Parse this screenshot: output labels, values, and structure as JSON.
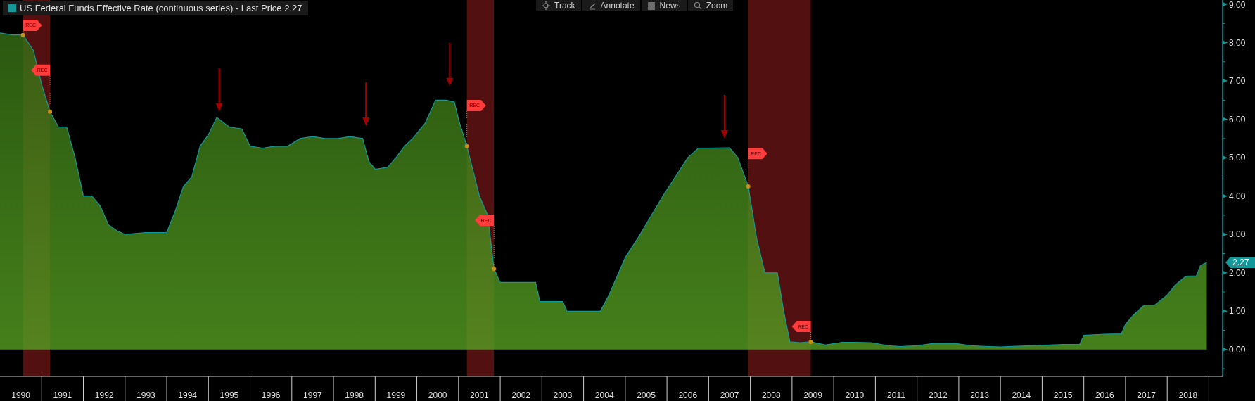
{
  "legend": {
    "label": "US Federal Funds Effective Rate (continuous series) - Last Price 2.27",
    "color": "#14999b"
  },
  "toolbar": [
    {
      "label": "Track"
    },
    {
      "label": "Annotate"
    },
    {
      "label": "News"
    },
    {
      "label": "Zoom"
    }
  ],
  "last_price_tag": "2.27",
  "chart_data": {
    "type": "area",
    "xlim": [
      1990,
      2019.33
    ],
    "ylim": [
      -0.7,
      9.11
    ],
    "yticks": [
      {
        "value": 0,
        "label": "0.00"
      },
      {
        "value": 1,
        "label": "1.00"
      },
      {
        "value": 2,
        "label": "2.00"
      },
      {
        "value": 3,
        "label": "3.00"
      },
      {
        "value": 4,
        "label": "4.00"
      },
      {
        "value": 5,
        "label": "5.00"
      },
      {
        "value": 6,
        "label": "6.00"
      },
      {
        "value": 7,
        "label": "7.00"
      },
      {
        "value": 8,
        "label": "8.00"
      },
      {
        "value": 9,
        "label": "9.00"
      }
    ],
    "xticks": [
      {
        "value": 1990.5,
        "label": "1990"
      },
      {
        "value": 1991.5,
        "label": "1991"
      },
      {
        "value": 1992.5,
        "label": "1992"
      },
      {
        "value": 1993.5,
        "label": "1993"
      },
      {
        "value": 1994.5,
        "label": "1994"
      },
      {
        "value": 1995.5,
        "label": "1995"
      },
      {
        "value": 1996.5,
        "label": "1996"
      },
      {
        "value": 1997.5,
        "label": "1997"
      },
      {
        "value": 1998.5,
        "label": "1998"
      },
      {
        "value": 1999.5,
        "label": "1999"
      },
      {
        "value": 2000.5,
        "label": "2000"
      },
      {
        "value": 2001.5,
        "label": "2001"
      },
      {
        "value": 2002.5,
        "label": "2002"
      },
      {
        "value": 2003.5,
        "label": "2003"
      },
      {
        "value": 2004.5,
        "label": "2004"
      },
      {
        "value": 2005.5,
        "label": "2005"
      },
      {
        "value": 2006.5,
        "label": "2006"
      },
      {
        "value": 2007.5,
        "label": "2007"
      },
      {
        "value": 2008.5,
        "label": "2008"
      },
      {
        "value": 2009.5,
        "label": "2009"
      },
      {
        "value": 2010.5,
        "label": "2010"
      },
      {
        "value": 2011.5,
        "label": "2011"
      },
      {
        "value": 2012.5,
        "label": "2012"
      },
      {
        "value": 2013.5,
        "label": "2013"
      },
      {
        "value": 2014.5,
        "label": "2014"
      },
      {
        "value": 2015.5,
        "label": "2015"
      },
      {
        "value": 2016.5,
        "label": "2016"
      },
      {
        "value": 2017.5,
        "label": "2017"
      },
      {
        "value": 2018.5,
        "label": "2018"
      }
    ],
    "x": [
      1990,
      1990.3,
      1990.55,
      1990.8,
      1991.0,
      1991.2,
      1991.4,
      1991.6,
      1991.8,
      1992.0,
      1992.2,
      1992.4,
      1992.6,
      1992.8,
      1993.0,
      1993.5,
      1994.0,
      1994.2,
      1994.4,
      1994.6,
      1994.8,
      1995.0,
      1995.2,
      1995.5,
      1995.8,
      1996.0,
      1996.3,
      1996.6,
      1996.9,
      1997.2,
      1997.5,
      1997.8,
      1998.1,
      1998.4,
      1998.7,
      1998.85,
      1999.0,
      1999.3,
      1999.5,
      1999.7,
      1999.9,
      2000.2,
      2000.45,
      2000.7,
      2000.9,
      2001.0,
      2001.2,
      2001.5,
      2001.7,
      2001.85,
      2002.0,
      2002.5,
      2002.85,
      2002.95,
      2003.5,
      2003.6,
      2004.4,
      2004.6,
      2004.8,
      2005.0,
      2005.3,
      2005.6,
      2005.9,
      2006.2,
      2006.5,
      2006.75,
      2007.0,
      2007.5,
      2007.7,
      2007.95,
      2008.15,
      2008.35,
      2008.65,
      2008.8,
      2008.95,
      2009.2,
      2009.45,
      2009.8,
      2010.2,
      2010.5,
      2010.9,
      2011.3,
      2011.6,
      2012.0,
      2012.4,
      2012.9,
      2013.3,
      2013.7,
      2014.0,
      2014.5,
      2015.0,
      2015.5,
      2015.9,
      2016.0,
      2016.5,
      2016.9,
      2017.0,
      2017.2,
      2017.45,
      2017.7,
      2018.0,
      2018.2,
      2018.45,
      2018.7,
      2018.8,
      2018.95
    ],
    "series": [
      {
        "color": "#14999b",
        "values": [
          8.25,
          8.2,
          8.2,
          7.8,
          6.9,
          6.2,
          5.8,
          5.8,
          5.0,
          4.0,
          4.0,
          3.75,
          3.25,
          3.1,
          3.0,
          3.05,
          3.05,
          3.6,
          4.25,
          4.5,
          5.3,
          5.6,
          6.05,
          5.8,
          5.75,
          5.3,
          5.25,
          5.3,
          5.3,
          5.5,
          5.55,
          5.5,
          5.5,
          5.55,
          5.5,
          4.9,
          4.7,
          4.75,
          5.0,
          5.3,
          5.5,
          5.9,
          6.5,
          6.5,
          6.45,
          6.0,
          5.3,
          4.0,
          3.5,
          2.1,
          1.75,
          1.75,
          1.75,
          1.25,
          1.25,
          1.0,
          1.0,
          1.4,
          1.9,
          2.4,
          2.9,
          3.45,
          4.0,
          4.5,
          5.0,
          5.25,
          5.25,
          5.26,
          5.0,
          4.25,
          2.9,
          2.0,
          2.0,
          1.0,
          0.2,
          0.18,
          0.2,
          0.12,
          0.19,
          0.19,
          0.18,
          0.1,
          0.08,
          0.1,
          0.16,
          0.16,
          0.1,
          0.08,
          0.07,
          0.09,
          0.11,
          0.13,
          0.13,
          0.37,
          0.4,
          0.41,
          0.66,
          0.91,
          1.16,
          1.16,
          1.42,
          1.69,
          1.91,
          1.92,
          2.19,
          2.27
        ]
      }
    ],
    "bands": [
      {
        "axis": "x",
        "from": 1990.55,
        "to": 1991.2
      },
      {
        "axis": "x",
        "from": 2001.2,
        "to": 2001.85
      },
      {
        "axis": "x",
        "from": 2007.95,
        "to": 2009.45
      }
    ],
    "annotations": [
      "REC",
      "REC",
      "REC",
      "REC",
      "REC",
      "REC"
    ]
  }
}
